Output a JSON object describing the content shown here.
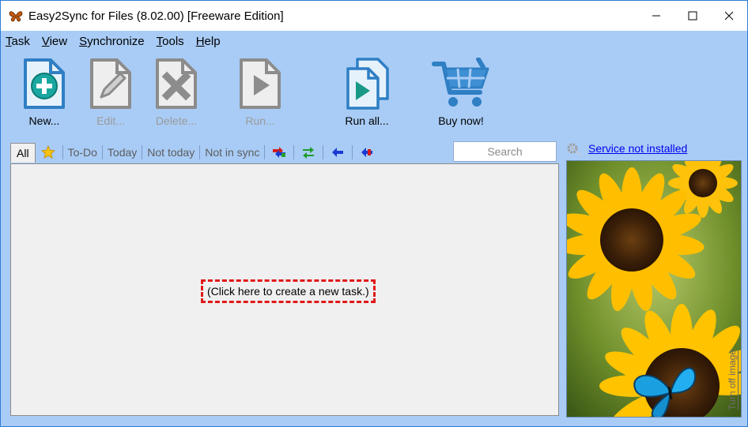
{
  "window": {
    "title": "Easy2Sync for Files (8.02.00) [Freeware Edition]",
    "controls": [
      "minimize-icon",
      "maximize-icon",
      "close-icon"
    ]
  },
  "menu": [
    {
      "label": "Task",
      "accel": "T",
      "rest": "ask"
    },
    {
      "label": "View",
      "accel": "V",
      "rest": "iew"
    },
    {
      "label": "Synchronize",
      "accel": "S",
      "rest": "ynchronize"
    },
    {
      "label": "Tools",
      "accel": "T",
      "rest": "ools"
    },
    {
      "label": "Help",
      "accel": "H",
      "rest": "elp"
    }
  ],
  "toolbar": {
    "new": "New...",
    "edit": "Edit...",
    "delete": "Delete...",
    "run": "Run...",
    "run_all": "Run all...",
    "buy_now": "Buy now!"
  },
  "filters": {
    "all": "All",
    "todo": "To-Do",
    "today": "Today",
    "not_today": "Not today",
    "not_in_sync": "Not in sync",
    "icons": [
      "star-icon",
      "multi-direction-icon",
      "both-directions-icon",
      "left-arrow-icon",
      "left-right-red-arrow-icon"
    ]
  },
  "search": {
    "placeholder": "Search"
  },
  "main": {
    "create_task": "(Click here to create a new task.)"
  },
  "service": {
    "status": "Service not installed"
  },
  "image_panel": {
    "turn_off": "Turn off image"
  },
  "colors": {
    "accent_blue": "#2d7bd6",
    "toolbar_bg": "#a9ccf6",
    "highlight_red": "#e01818",
    "link_blue": "#0000ee"
  }
}
